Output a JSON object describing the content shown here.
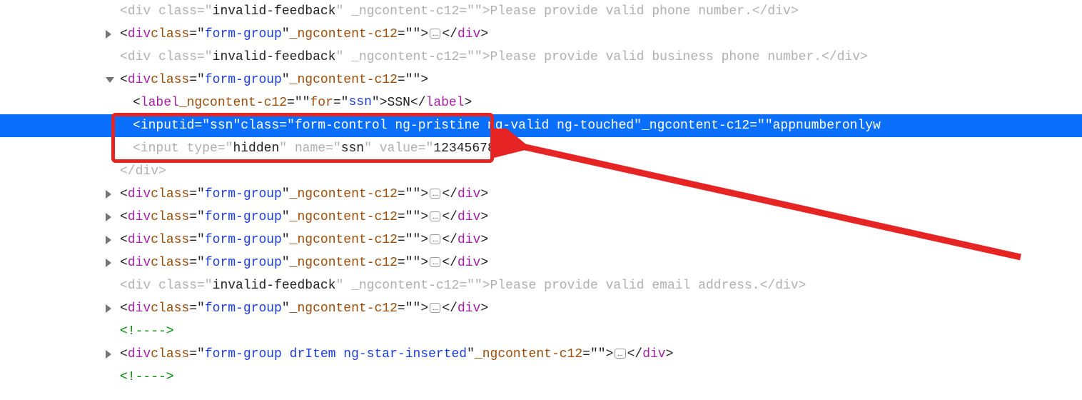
{
  "lines": {
    "l1": {
      "open": "<",
      "tag": "div ",
      "a1": "class",
      "eq": "=\"",
      "v1": "invalid-feedback",
      "q": "\" ",
      "a2": "_ngcontent-c12",
      "eq2": "=\"\"",
      "gt": ">",
      "text": "Please provide valid phone number.",
      "close": "</",
      "ctag": "div",
      "cgt": ">"
    },
    "l2": {
      "open": "<",
      "tag": "div ",
      "a1": "class",
      "eq": "=\"",
      "v1": "form-group",
      "q": "\" ",
      "a2": "_ngcontent-c12",
      "eq2": "=\"\"",
      "gt": ">",
      "close": "</",
      "ctag": "div",
      "cgt": ">"
    },
    "l3": {
      "open": "<",
      "tag": "div ",
      "a1": "class",
      "eq": "=\"",
      "v1": "invalid-feedback",
      "q": "\" ",
      "a2": "_ngcontent-c12",
      "eq2": "=\"\"",
      "gt": ">",
      "text": "Please provide valid business phone number.",
      "close": "</",
      "ctag": "div",
      "cgt": ">"
    },
    "l4": {
      "open": "<",
      "tag": "div ",
      "a1": "class",
      "eq": "=\"",
      "v1": "form-group",
      "q": "\" ",
      "a2": "_ngcontent-c12",
      "eq2": "=\"\"",
      "gt": ">"
    },
    "l5": {
      "open": "<",
      "tag": "label ",
      "a1": "_ngcontent-c12",
      "eq1": "=\"\" ",
      "a2": "for",
      "eq2": "=\"",
      "v2": "ssn",
      "q2": "\"",
      "gt": ">",
      "text": "SSN",
      "close": "</",
      "ctag": "label",
      "cgt": ">"
    },
    "l6": {
      "open": "<",
      "tag": "input ",
      "a1": "id",
      "eq1": "=\"",
      "v1": "ssn",
      "q1": "\" ",
      "a2": "class",
      "eq2": "=\"",
      "v2": "form-control ng-pristine ng-valid ng-touched",
      "q2": "\" ",
      "a3": "_ngcontent-c12",
      "eq3": "=\"\" ",
      "a4": "appnumberonlyw"
    },
    "l7": {
      "open": "<",
      "tag": "input ",
      "a1": "type",
      "eq1": "=\"",
      "v1": "hidden",
      "q1": "\" ",
      "a2": "name",
      "eq2": "=\"",
      "v2": "ssn",
      "q2": "\" ",
      "a3": "value",
      "eq3": "=\"",
      "v3": "123456789",
      "q3": "\"",
      "gt": ">"
    },
    "l8": {
      "close": "</",
      "ctag": "div",
      "cgt": ">"
    },
    "l13": {
      "open": "<",
      "tag": "div ",
      "a1": "class",
      "eq": "=\"",
      "v1": "invalid-feedback",
      "q": "\" ",
      "a2": "_ngcontent-c12",
      "eq2": "=\"\"",
      "gt": ">",
      "text": "Please provide valid email address.",
      "close": "</",
      "ctag": "div",
      "cgt": ">"
    },
    "l15": {
      "text": "<!---->"
    },
    "l16": {
      "open": "<",
      "tag": "div ",
      "a1": "class",
      "eq": "=\"",
      "v1": "form-group drItem ng-star-inserted",
      "q": "\" ",
      "a2": "_ngcontent-c12",
      "eq2": "=\"\"",
      "gt": ">",
      "close": "</",
      "ctag": "div",
      "cgt": ">"
    },
    "ellipsis": "…"
  }
}
